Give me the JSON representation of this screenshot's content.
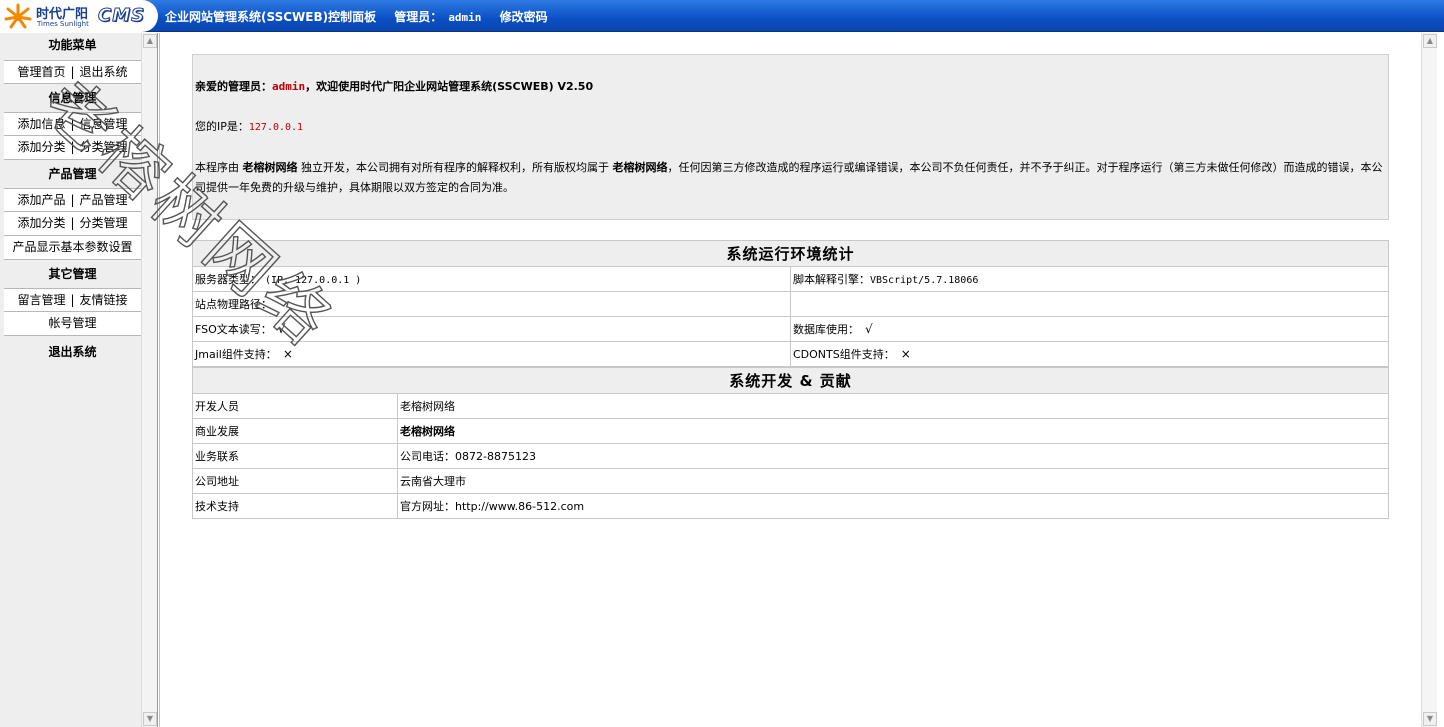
{
  "header": {
    "logo_cn": "时代广阳",
    "logo_en": "Times Sunlight",
    "logo_cms": "CMS",
    "title": "企业网站管理系统(SSCWEB)控制面板",
    "admin_label": "管理员：",
    "admin_name": "admin",
    "change_password": "修改密码"
  },
  "sidebar": {
    "sections": {
      "func": "功能菜单",
      "info": "信息管理",
      "product": "产品管理",
      "other": "其它管理",
      "logout": "退出系统"
    },
    "links": {
      "home": "管理首页",
      "logout": "退出系统",
      "add_info": "添加信息",
      "info_manage": "信息管理",
      "add_category_1": "添加分类",
      "category_manage_1": "分类管理",
      "add_product": "添加产品",
      "product_manage": "产品管理",
      "add_category_2": "添加分类",
      "category_manage_2": "分类管理",
      "product_display_settings": "产品显示基本参数设置",
      "message_manage": "留言管理",
      "friend_links": "友情链接",
      "account_manage": "帐号管理"
    },
    "separator": "|"
  },
  "welcome": {
    "greet_prefix": "亲爱的管理员：",
    "admin_name": "admin",
    "greet_suffix": "，欢迎使用时代广阳企业网站管理系统(SSCWEB) V2.50",
    "ip_label": "您的IP是：",
    "ip_value": "127.0.0.1",
    "copyright_1": "本程序由 ",
    "company": "老榕树网络",
    "copyright_2": " 独立开发，本公司拥有对所有程序的解释权利，所有版权均属于 ",
    "copyright_3": "，任何因第三方修改造成的程序运行或编译错误，本公司不负任何责任，并不予于纠正。对于程序运行（第三方未做任何修改）而造成的错误，本公司提供一年免费的升级与维护，具体期限以双方签定的合同为准。"
  },
  "env": {
    "title": "系统运行环境统计",
    "server_type_label": "服务器类型：",
    "server_type_value": "(IP: 127.0.0.1 )",
    "script_engine_label": "脚本解释引擎：",
    "script_engine_value": "VBScript/5.7.18066",
    "physical_path_label": "站点物理路径：",
    "physical_path_value": "",
    "fso_label": "FSO文本读写：",
    "fso_value": "√",
    "db_label": "数据库使用：",
    "db_value": "√",
    "jmail_label": "Jmail组件支持：",
    "jmail_value": "×",
    "cdonts_label": "CDONTS组件支持：",
    "cdonts_value": "×"
  },
  "dev": {
    "title": "系统开发 & 贡献",
    "rows": [
      {
        "key": "开发人员",
        "value": "老榕树网络"
      },
      {
        "key": "商业发展",
        "value": "老榕树网络"
      },
      {
        "key": "业务联系",
        "value": "公司电话：0872-8875123"
      },
      {
        "key": "公司地址",
        "value": "云南省大理市"
      },
      {
        "key": "技术支持",
        "value": "官方网址：http://www.86-512.com"
      }
    ]
  },
  "watermark": "老榕树网络",
  "colors": {
    "header_blue": "#0b4fc4",
    "highlight_red": "#c00000",
    "panel_gray": "#eeeeee"
  }
}
